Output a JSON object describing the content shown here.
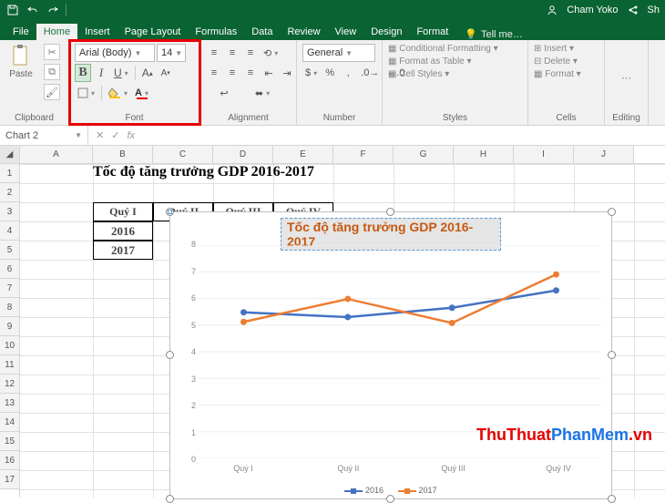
{
  "titlebar": {
    "user": "Cham Yoko",
    "share": "Sh"
  },
  "tabs": {
    "file": "File",
    "items": [
      "Home",
      "Insert",
      "Page Layout",
      "Formulas",
      "Data",
      "Review",
      "View",
      "Design",
      "Format"
    ],
    "active": 0,
    "tell": "Tell me…"
  },
  "ribbon": {
    "clipboard": {
      "label": "Clipboard",
      "paste": "Paste"
    },
    "font": {
      "label": "Font",
      "name": "Arial (Body)",
      "size": "14"
    },
    "alignment": {
      "label": "Alignment"
    },
    "number": {
      "label": "Number",
      "format": "General"
    },
    "styles": {
      "label": "Styles",
      "cf": "Conditional Formatting",
      "fat": "Format as Table",
      "cs": "Cell Styles"
    },
    "cells": {
      "label": "Cells",
      "ins": "Insert",
      "del": "Delete",
      "fmt": "Format"
    },
    "editing": {
      "label": "Editing"
    }
  },
  "namebox": {
    "value": "Chart 2",
    "fx": "fx"
  },
  "cols": [
    "A",
    "B",
    "C",
    "D",
    "E",
    "F",
    "G",
    "H",
    "I",
    "J"
  ],
  "rows": [
    "1",
    "2",
    "3",
    "4",
    "5",
    "6",
    "7",
    "8",
    "9",
    "10",
    "11",
    "12",
    "13",
    "14",
    "15",
    "16",
    "17"
  ],
  "sheet": {
    "title": "Tốc độ tăng trưởng GDP 2016-2017",
    "colhdrs": [
      "Quý I",
      "Quý II",
      "Quý III",
      "Quý IV"
    ],
    "rowhdrs": [
      "2016",
      "2017"
    ]
  },
  "chart_data": {
    "type": "line",
    "title": "Tốc độ tăng trưởng GDP 2016-2017",
    "categories": [
      "Quý I",
      "Quý II",
      "Quý III",
      "Quý IV"
    ],
    "series": [
      {
        "name": "2016",
        "color": "#4472c4",
        "values": [
          5.48,
          5.3,
          5.65,
          6.3
        ]
      },
      {
        "name": "2017",
        "color": "#ed7d31",
        "values": [
          5.12,
          5.98,
          5.08,
          6.9
        ]
      }
    ],
    "ylabel": "",
    "xlabel": "",
    "ylim": [
      0,
      8
    ],
    "yticks": [
      0,
      1,
      2,
      3,
      4,
      5,
      6,
      7,
      8
    ]
  },
  "watermark": {
    "a": "ThuThuat",
    "b": "PhanMem",
    "c": ".vn"
  }
}
